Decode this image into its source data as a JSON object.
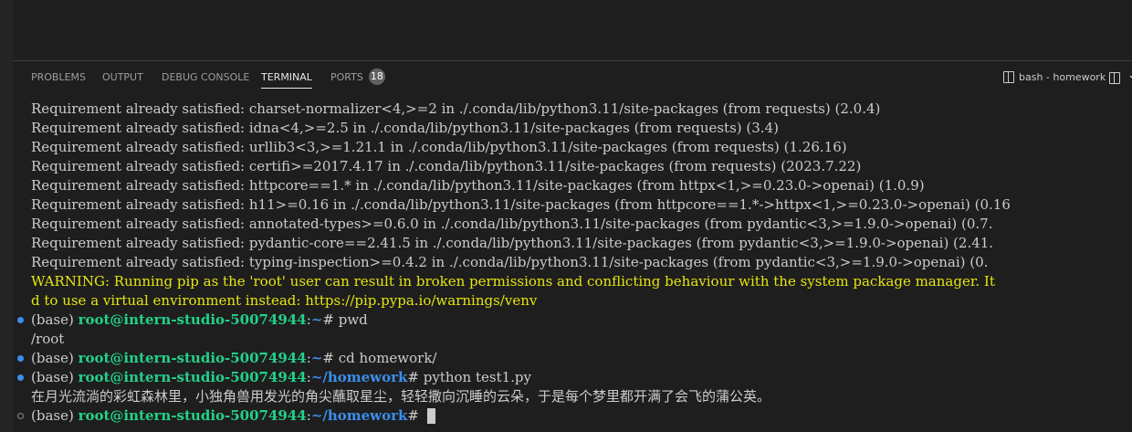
{
  "panel": {
    "tabs": [
      {
        "label": "PROBLEMS"
      },
      {
        "label": "OUTPUT"
      },
      {
        "label": "DEBUG CONSOLE"
      },
      {
        "label": "TERMINAL"
      },
      {
        "label": "PORTS",
        "badge": "18"
      }
    ],
    "active_tab": "TERMINAL",
    "terminal_name": "bash - homework"
  },
  "terminal": {
    "requirement_lines": [
      "Requirement already satisfied: charset-normalizer<4,>=2 in ./.conda/lib/python3.11/site-packages (from requests) (2.0.4)",
      "Requirement already satisfied: idna<4,>=2.5 in ./.conda/lib/python3.11/site-packages (from requests) (3.4)",
      "Requirement already satisfied: urllib3<3,>=1.21.1 in ./.conda/lib/python3.11/site-packages (from requests) (1.26.16)",
      "Requirement already satisfied: certifi>=2017.4.17 in ./.conda/lib/python3.11/site-packages (from requests) (2023.7.22)",
      "Requirement already satisfied: httpcore==1.* in ./.conda/lib/python3.11/site-packages (from httpx<1,>=0.23.0->openai) (1.0.9)",
      "Requirement already satisfied: h11>=0.16 in ./.conda/lib/python3.11/site-packages (from httpcore==1.*->httpx<1,>=0.23.0->openai) (0.16",
      "Requirement already satisfied: annotated-types>=0.6.0 in ./.conda/lib/python3.11/site-packages (from pydantic<3,>=1.9.0->openai) (0.7.",
      "Requirement already satisfied: pydantic-core==2.41.5 in ./.conda/lib/python3.11/site-packages (from pydantic<3,>=1.9.0->openai) (2.41.",
      "Requirement already satisfied: typing-inspection>=0.4.2 in ./.conda/lib/python3.11/site-packages (from pydantic<3,>=1.9.0->openai) (0."
    ],
    "warning_lines": [
      "WARNING: Running pip as the 'root' user can result in broken permissions and conflicting behaviour with the system package manager. It",
      "d to use a virtual environment instead: https://pip.pypa.io/warnings/venv"
    ],
    "env_prefix": "(base) ",
    "user_host": "root@intern-studio-50074944",
    "colon": ":",
    "dollar": "# ",
    "home_path": "~",
    "homework_path": "~/homework",
    "cmd_pwd": "pwd",
    "pwd_output": "/root",
    "cmd_cd": "cd homework/",
    "cmd_python": "python test1.py",
    "python_output": "在月光流淌的彩虹森林里，小独角兽用发光的角尖蘸取星尘，轻轻撒向沉睡的云朵，于是每个梦里都开满了会飞的蒲公英。"
  },
  "colors": {
    "background": "#1e1e1e",
    "text": "#cccccc",
    "warning": "#e5e510",
    "user_host": "#23d18b",
    "path": "#3b8eea"
  }
}
